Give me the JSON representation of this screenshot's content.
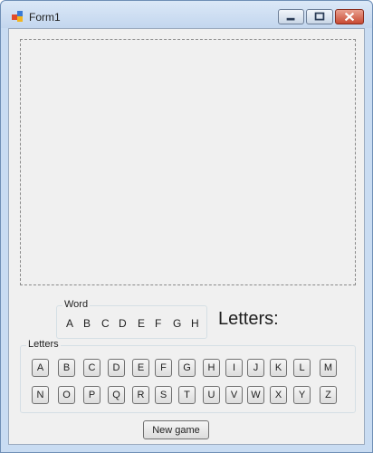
{
  "window": {
    "title": "Form1"
  },
  "word": {
    "label": "Word",
    "letters": [
      "A",
      "B",
      "C",
      "D",
      "E",
      "F",
      "G",
      "H"
    ]
  },
  "letters_heading": "Letters:",
  "letters_group": {
    "label": "Letters",
    "row1": [
      "A",
      "B",
      "C",
      "D",
      "E",
      "F",
      "G",
      "H",
      "I",
      "J",
      "K",
      "L",
      "M"
    ],
    "row2": [
      "N",
      "O",
      "P",
      "Q",
      "R",
      "S",
      "T",
      "U",
      "V",
      "W",
      "X",
      "Y",
      "Z"
    ]
  },
  "new_game_label": "New game",
  "icons": {
    "app": "app-icon",
    "minimize": "minimize-icon",
    "maximize": "maximize-icon",
    "close": "close-icon"
  },
  "colors": {
    "title_bar": "#c3d6ee",
    "client_bg": "#f0f0f0",
    "close_button": "#c84a33"
  }
}
